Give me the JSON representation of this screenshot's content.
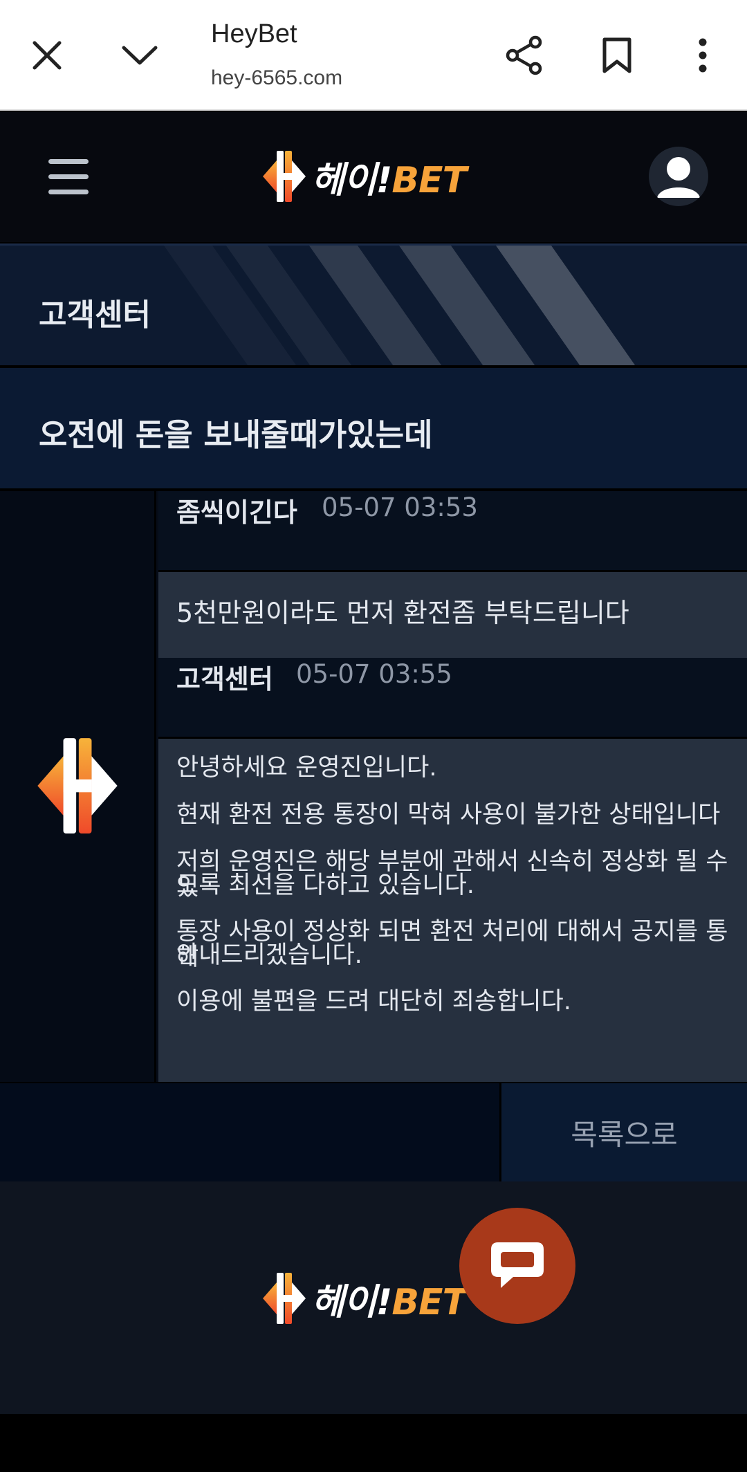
{
  "browser": {
    "title": "HeyBet",
    "url": "hey-6565.com",
    "icons": [
      "close-icon",
      "chevron-down-icon",
      "share-icon",
      "bookmark-icon",
      "more-vert-icon"
    ]
  },
  "header": {
    "logo_korean": "헤이!",
    "logo_english": "BET",
    "icons": [
      "menu-icon",
      "user-avatar-icon"
    ]
  },
  "banner": {
    "title": "고객센터"
  },
  "post": {
    "title": "오전에 돈을 보내줄때가있는데"
  },
  "messages": [
    {
      "name": "좀씩이긴다",
      "time": "05-07 03:53"
    },
    {
      "body": "5천만원이라도 먼저 환전좀 부탁드립니다"
    },
    {
      "name": "고객센터",
      "time": "05-07 03:55"
    },
    {
      "body_lines": [
        "안녕하세요 운영진입니다.",
        "현재 환전 전용 통장이 막혀 사용이 불가한 상태입니다",
        "저희 운영진은 해당 부분에 관해서 신속히 정상화 될 수 있",
        "도록 최선을 다하고 있습니다.",
        "통장 사용이 정상화 되면 환전 처리에 대해서 공지를 통해",
        "안내드리겠습니다.",
        "이용에 불편을 드려 대단히 죄송합니다."
      ]
    }
  ],
  "actions": {
    "list_label": "목록으로"
  },
  "footer": {
    "logo_korean": "헤이!",
    "logo_english": "BET"
  },
  "colors": {
    "accent_orange": "#f7a33a",
    "chat_button": "#a8391a",
    "navy": "#0b1a33"
  }
}
